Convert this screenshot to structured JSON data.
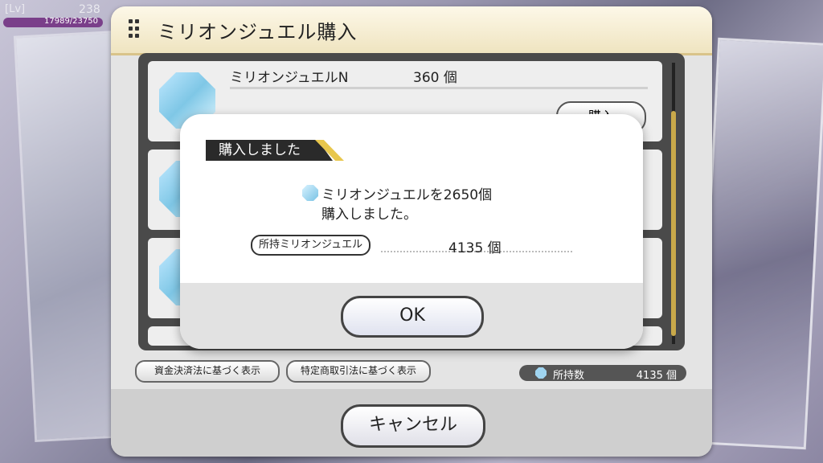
{
  "hud": {
    "lv_label": "[Lv]",
    "level": "238",
    "exp": "17989/23750"
  },
  "panel": {
    "title": "ミリオンジュエル購入",
    "items": [
      {
        "name": "ミリオンジュエルN",
        "qty": "360 個",
        "buy_label": "購入"
      }
    ],
    "law_button_1": "資金決済法に基づく表示",
    "law_button_2": "特定商取引法に基づく表示",
    "owned_label": "所持数",
    "owned_value": "4135 個",
    "cancel_label": "キャンセル"
  },
  "dialog": {
    "title": "購入しました",
    "message_line1": "ミリオンジュエルを2650個",
    "message_line2": "購入しました。",
    "owned_pill": "所持ミリオンジュエル",
    "owned_value": "4135 個",
    "ok_label": "OK"
  },
  "colors": {
    "accent_gold": "#e8c74d",
    "dark": "#2a2a2a"
  }
}
